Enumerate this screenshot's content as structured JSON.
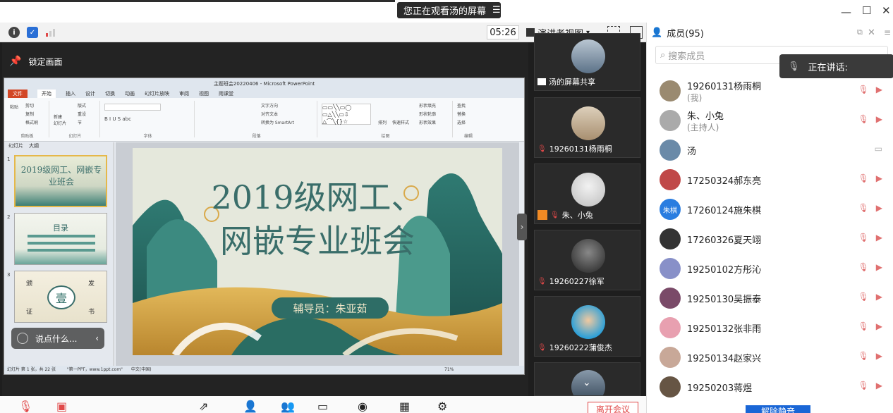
{
  "share_banner": {
    "text": "您正在观看汤的屏幕"
  },
  "toolbar": {
    "timer": "05:26",
    "view_mode": "演讲者视图",
    "view_arrow": "▾"
  },
  "share": {
    "lock_label": "锁定画面",
    "ppt": {
      "title": "主题班会20220406 - Microsoft PowerPoint",
      "tabs": [
        "文件",
        "开始",
        "插入",
        "设计",
        "切换",
        "动画",
        "幻灯片放映",
        "审阅",
        "视图",
        "雨课堂"
      ],
      "groups": [
        "剪贴板",
        "幻灯片",
        "字体",
        "段落",
        "绘图",
        "编辑"
      ],
      "ribbon_items": {
        "paste": "粘贴",
        "cut": "剪切",
        "copy": "复制",
        "format_painter": "格式刷",
        "new_slide": "新建\n幻灯片",
        "layout": "版式",
        "reset": "重设",
        "section": "节",
        "text_direction": "文字方向",
        "align_text": "对齐文本",
        "smartart": "转换为 SmartArt",
        "arrange": "排列",
        "quick_styles": "快速样式",
        "shape_fill": "形状填充",
        "shape_outline": "形状轮廓",
        "shape_effects": "形状效果",
        "find": "查找",
        "replace": "替换",
        "select": "选择"
      },
      "thumb_tabs": [
        "幻灯片",
        "大纲"
      ],
      "thumbs": [
        {
          "num": "1",
          "title": "2019级网工、网嵌专业班会"
        },
        {
          "num": "2",
          "title": "目录"
        },
        {
          "num": "3",
          "title": "壹"
        }
      ],
      "thumb3_labels": [
        "颁",
        "发",
        "证",
        "书"
      ],
      "slide": {
        "title_line1": "2019级网工、",
        "title_line2": "网嵌专业班会",
        "advisor": "辅导员：朱亚茹"
      },
      "status": {
        "left": "幻灯片 第 1 张，共 22 张",
        "theme": "\"第一PPT，www.1ppt.com\"",
        "lang": "中文(中国)",
        "zoom": "71%"
      }
    },
    "chat_placeholder": "说点什么..."
  },
  "tiles": [
    {
      "label": "汤的屏幕共享",
      "avatar_color": "#7f95a8"
    },
    {
      "label": "19260131杨雨桐",
      "avatar_color": "#c8b59a"
    },
    {
      "label": "朱、小兔",
      "avatar_color": "#d8d8d8"
    },
    {
      "label": "19260227徐军",
      "avatar_color": "#555555"
    },
    {
      "label": "19260222蒲俊杰",
      "avatar_color": "#2da0d8"
    },
    {
      "label": "",
      "avatar_color": "#445566"
    }
  ],
  "members": {
    "header": "成员(95)",
    "search_placeholder": "搜索成员",
    "speaking_label": "正在讲话:",
    "list": [
      {
        "name": "19260131杨雨桐",
        "sub": "(我)",
        "avatar_color": "#9a8a70"
      },
      {
        "name": "朱、小兔",
        "sub": "(主持人)",
        "avatar_color": "#aaaaaa"
      },
      {
        "name": "汤",
        "sub": "",
        "avatar_color": "#6a8aa8"
      },
      {
        "name": "17250324郝东亮",
        "sub": "",
        "avatar_color": "#c04848"
      },
      {
        "name": "17260124施朱棋",
        "sub": "",
        "avatar_color": "#2a7de0",
        "avatar_text": "朱棋"
      },
      {
        "name": "17260326夏天翊",
        "sub": "",
        "avatar_color": "#333333"
      },
      {
        "name": "19250102方彤沁",
        "sub": "",
        "avatar_color": "#8890c8"
      },
      {
        "name": "19250130吴振泰",
        "sub": "",
        "avatar_color": "#7a4a68"
      },
      {
        "name": "19250132张非雨",
        "sub": "",
        "avatar_color": "#e8a0b0"
      },
      {
        "name": "19250134赵家兴",
        "sub": "",
        "avatar_color": "#c8a898"
      },
      {
        "name": "19250203蒋煜",
        "sub": "",
        "avatar_color": "#665544"
      }
    ]
  },
  "bottom": {
    "leave": "离开会议",
    "unmute": "解除静音"
  },
  "colors": {
    "accent_blue": "#1a66d6",
    "danger_red": "#e04848",
    "slide_teal": "#2e6d66"
  }
}
